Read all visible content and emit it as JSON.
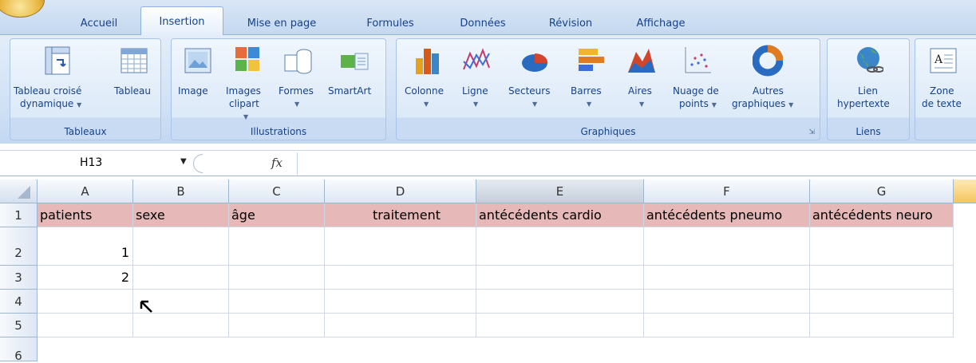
{
  "tabs": [
    {
      "label": "Accueil",
      "active": false
    },
    {
      "label": "Insertion",
      "active": true
    },
    {
      "label": "Mise en page",
      "active": false
    },
    {
      "label": "Formules",
      "active": false
    },
    {
      "label": "Données",
      "active": false
    },
    {
      "label": "Révision",
      "active": false
    },
    {
      "label": "Affichage",
      "active": false
    }
  ],
  "ribbon": {
    "tableaux": {
      "label": "Tableaux",
      "tcd_line1": "Tableau croisé",
      "tcd_line2": "dynamique",
      "tableau": "Tableau"
    },
    "illustrations": {
      "label": "Illustrations",
      "image": "Image",
      "images_line1": "Images",
      "images_line2": "clipart",
      "formes": "Formes",
      "smartart": "SmartArt"
    },
    "graphiques": {
      "label": "Graphiques",
      "colonne": "Colonne",
      "ligne": "Ligne",
      "secteurs": "Secteurs",
      "barres": "Barres",
      "aires": "Aires",
      "nuage_line1": "Nuage de",
      "nuage_line2": "points",
      "autres_line1": "Autres",
      "autres_line2": "graphiques"
    },
    "liens": {
      "label": "Liens",
      "lien_line1": "Lien",
      "lien_line2": "hypertexte"
    },
    "texte": {
      "zone_line1": "Zone",
      "zone_line2": "de texte"
    }
  },
  "formula_bar": {
    "name_box": "H13",
    "fx": "fx",
    "formula": ""
  },
  "sheet": {
    "columns": [
      "A",
      "B",
      "C",
      "D",
      "E",
      "F",
      "G"
    ],
    "selected_column": "E",
    "rows": [
      "1",
      "2",
      "3",
      "4",
      "5",
      "6"
    ],
    "header_row": [
      "patients",
      "sexe",
      "âge",
      "traitement",
      "antécédents cardio",
      "antécédents pneumo",
      "antécédents neuro"
    ],
    "data": [
      [
        "1",
        "",
        "",
        "",
        "",
        "",
        ""
      ],
      [
        "2",
        "",
        "",
        "",
        "",
        "",
        ""
      ]
    ]
  },
  "colors": {
    "header_fill": "#e6b8b7",
    "ribbon_text": "#15428b",
    "grid_line": "#d0d7e5"
  }
}
